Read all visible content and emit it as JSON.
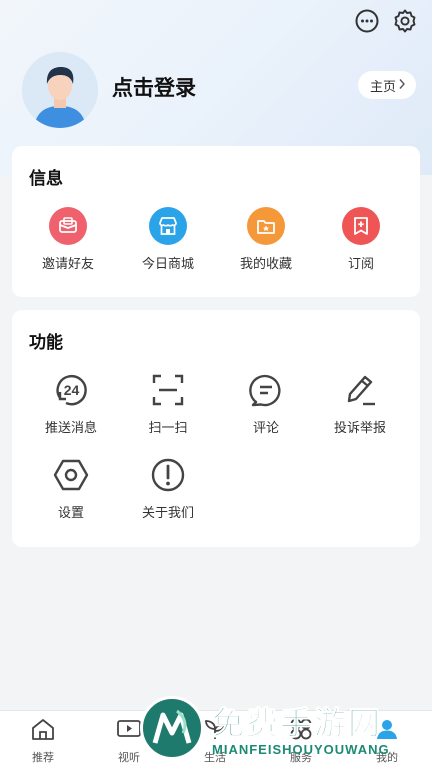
{
  "header": {
    "login_text": "点击登录",
    "home_button": "主页"
  },
  "info_section": {
    "title": "信息",
    "items": [
      {
        "label": "邀请好友",
        "icon": "invite-icon",
        "color": "#f0616e"
      },
      {
        "label": "今日商城",
        "icon": "store-icon",
        "color": "#2ba3e8"
      },
      {
        "label": "我的收藏",
        "icon": "favorites-icon",
        "color": "#f5983a"
      },
      {
        "label": "订阅",
        "icon": "subscribe-icon",
        "color": "#f05555"
      }
    ]
  },
  "function_section": {
    "title": "功能",
    "items": [
      {
        "label": "推送消息",
        "icon": "push-24-icon"
      },
      {
        "label": "扫一扫",
        "icon": "scan-icon"
      },
      {
        "label": "评论",
        "icon": "comment-icon"
      },
      {
        "label": "投诉举报",
        "icon": "report-pen-icon"
      },
      {
        "label": "设置",
        "icon": "settings-hexagon-icon"
      },
      {
        "label": "关于我们",
        "icon": "about-exclamation-icon"
      }
    ]
  },
  "bottom_nav": {
    "items": [
      {
        "label": "推荐",
        "icon": "home-icon"
      },
      {
        "label": "视听",
        "icon": "video-icon"
      },
      {
        "label": "生活",
        "icon": "plant-icon"
      },
      {
        "label": "服务",
        "icon": "service-icon"
      },
      {
        "label": "我的",
        "icon": "user-icon"
      }
    ]
  },
  "watermark": {
    "title": "免费手游网",
    "subtitle": "MIANFEISHOUYOUWANG"
  }
}
